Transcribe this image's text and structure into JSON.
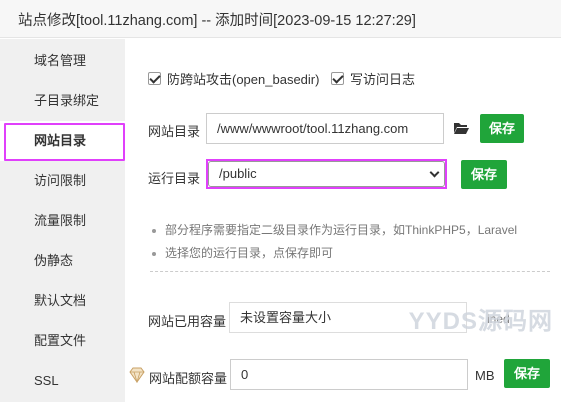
{
  "window": {
    "title": "站点修改[tool.11zhang.com] -- 添加时间[2023-09-15 12:27:29]"
  },
  "sidebar": {
    "items": [
      {
        "label": "域名管理"
      },
      {
        "label": "子目录绑定"
      },
      {
        "label": "网站目录"
      },
      {
        "label": "访问限制"
      },
      {
        "label": "流量限制"
      },
      {
        "label": "伪静态"
      },
      {
        "label": "默认文档"
      },
      {
        "label": "配置文件"
      },
      {
        "label": "SSL"
      }
    ],
    "active_index": 2
  },
  "main": {
    "checkbox_open_basedir": {
      "label": "防跨站攻击(open_basedir)",
      "checked": true
    },
    "checkbox_access_log": {
      "label": "写访问日志",
      "checked": true
    },
    "site_dir": {
      "label": "网站目录",
      "value": "/www/wwwroot/tool.11zhang.com",
      "save_label": "保存"
    },
    "run_dir": {
      "label": "运行目录",
      "value": "/public",
      "save_label": "保存"
    },
    "tips": [
      "部分程序需要指定二级目录作为运行目录，如ThinkPHP5，Laravel",
      "选择您的运行目录，点保存即可"
    ],
    "used_capacity": {
      "label": "网站已用容量",
      "value": "未设置容量大小",
      "extra_text": "ined"
    },
    "quota": {
      "label": "网站配额容量",
      "value": "0",
      "unit": "MB",
      "save_label": "保存"
    },
    "watermark": "YYDS源码网"
  },
  "colors": {
    "accent_green": "#20a53a",
    "highlight_magenta": "#e040fb",
    "sidebar_bg": "#f0f0f0"
  },
  "icons": {
    "folder": "folder-open-icon",
    "vip": "diamond-icon"
  }
}
